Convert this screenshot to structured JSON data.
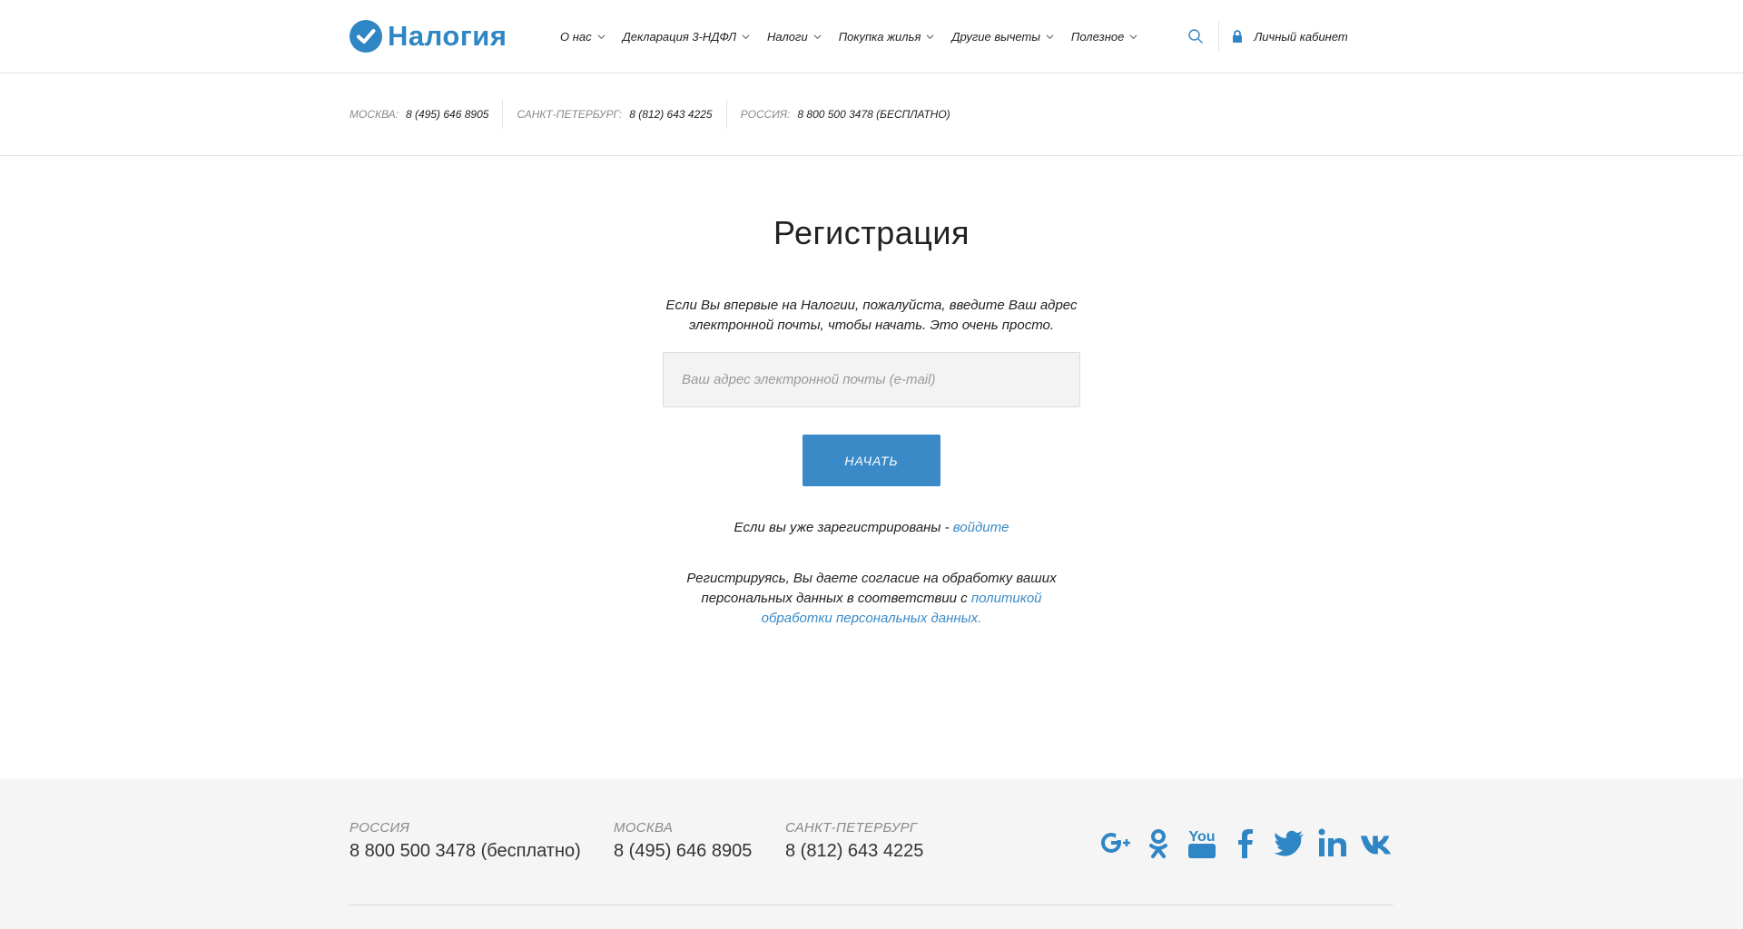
{
  "brand": {
    "name": "Налогия",
    "accent": "#2f86c5",
    "icon": "check-circle-icon"
  },
  "nav": [
    {
      "label": "О нас"
    },
    {
      "label": "Декларация 3-НДФЛ"
    },
    {
      "label": "Налоги"
    },
    {
      "label": "Покупка жилья"
    },
    {
      "label": "Другие вычеты"
    },
    {
      "label": "Полезное"
    }
  ],
  "header": {
    "search_icon": "search-icon",
    "lock_icon": "lock-icon",
    "cabinet_label": "Личный кабинет"
  },
  "phones": [
    {
      "city": "МОСКВА:",
      "number": "8 (495) 646 8905"
    },
    {
      "city": "САНКТ-ПЕТЕРБУРГ:",
      "number": "8 (812) 643 4225"
    },
    {
      "city": "РОССИЯ:",
      "number": "8 800 500 3478 (БЕСПЛАТНО)"
    }
  ],
  "registration": {
    "title": "Регистрация",
    "intro": "Если Вы впервые на Налогии, пожалуйста, введите Ваш адрес электронной почты, чтобы начать. Это очень просто.",
    "email_placeholder": "Ваш адрес электронной почты (e-mail)",
    "email_value": "",
    "start_label": "НАЧАТЬ",
    "login_text": "Если вы уже зарегистрированы - ",
    "login_link": "войдите",
    "consent_text": "Регистрируясь, Вы даете согласие на обработку ваших персональных данных в соответствии с ",
    "consent_link": "политикой обработки персональных данных."
  },
  "footer": {
    "contacts": [
      {
        "city": "РОССИЯ",
        "phone": "8 800 500 3478 (бесплатно)"
      },
      {
        "city": "МОСКВА",
        "phone": "8 (495) 646 8905"
      },
      {
        "city": "САНКТ-ПЕТЕРБУРГ",
        "phone": "8 (812) 643 4225"
      }
    ],
    "socials": [
      "google-plus-icon",
      "odnoklassniki-icon",
      "youtube-icon",
      "facebook-icon",
      "twitter-icon",
      "linkedin-icon",
      "vk-icon"
    ],
    "social_color": "#2f86c5",
    "youtube_text": "You"
  }
}
